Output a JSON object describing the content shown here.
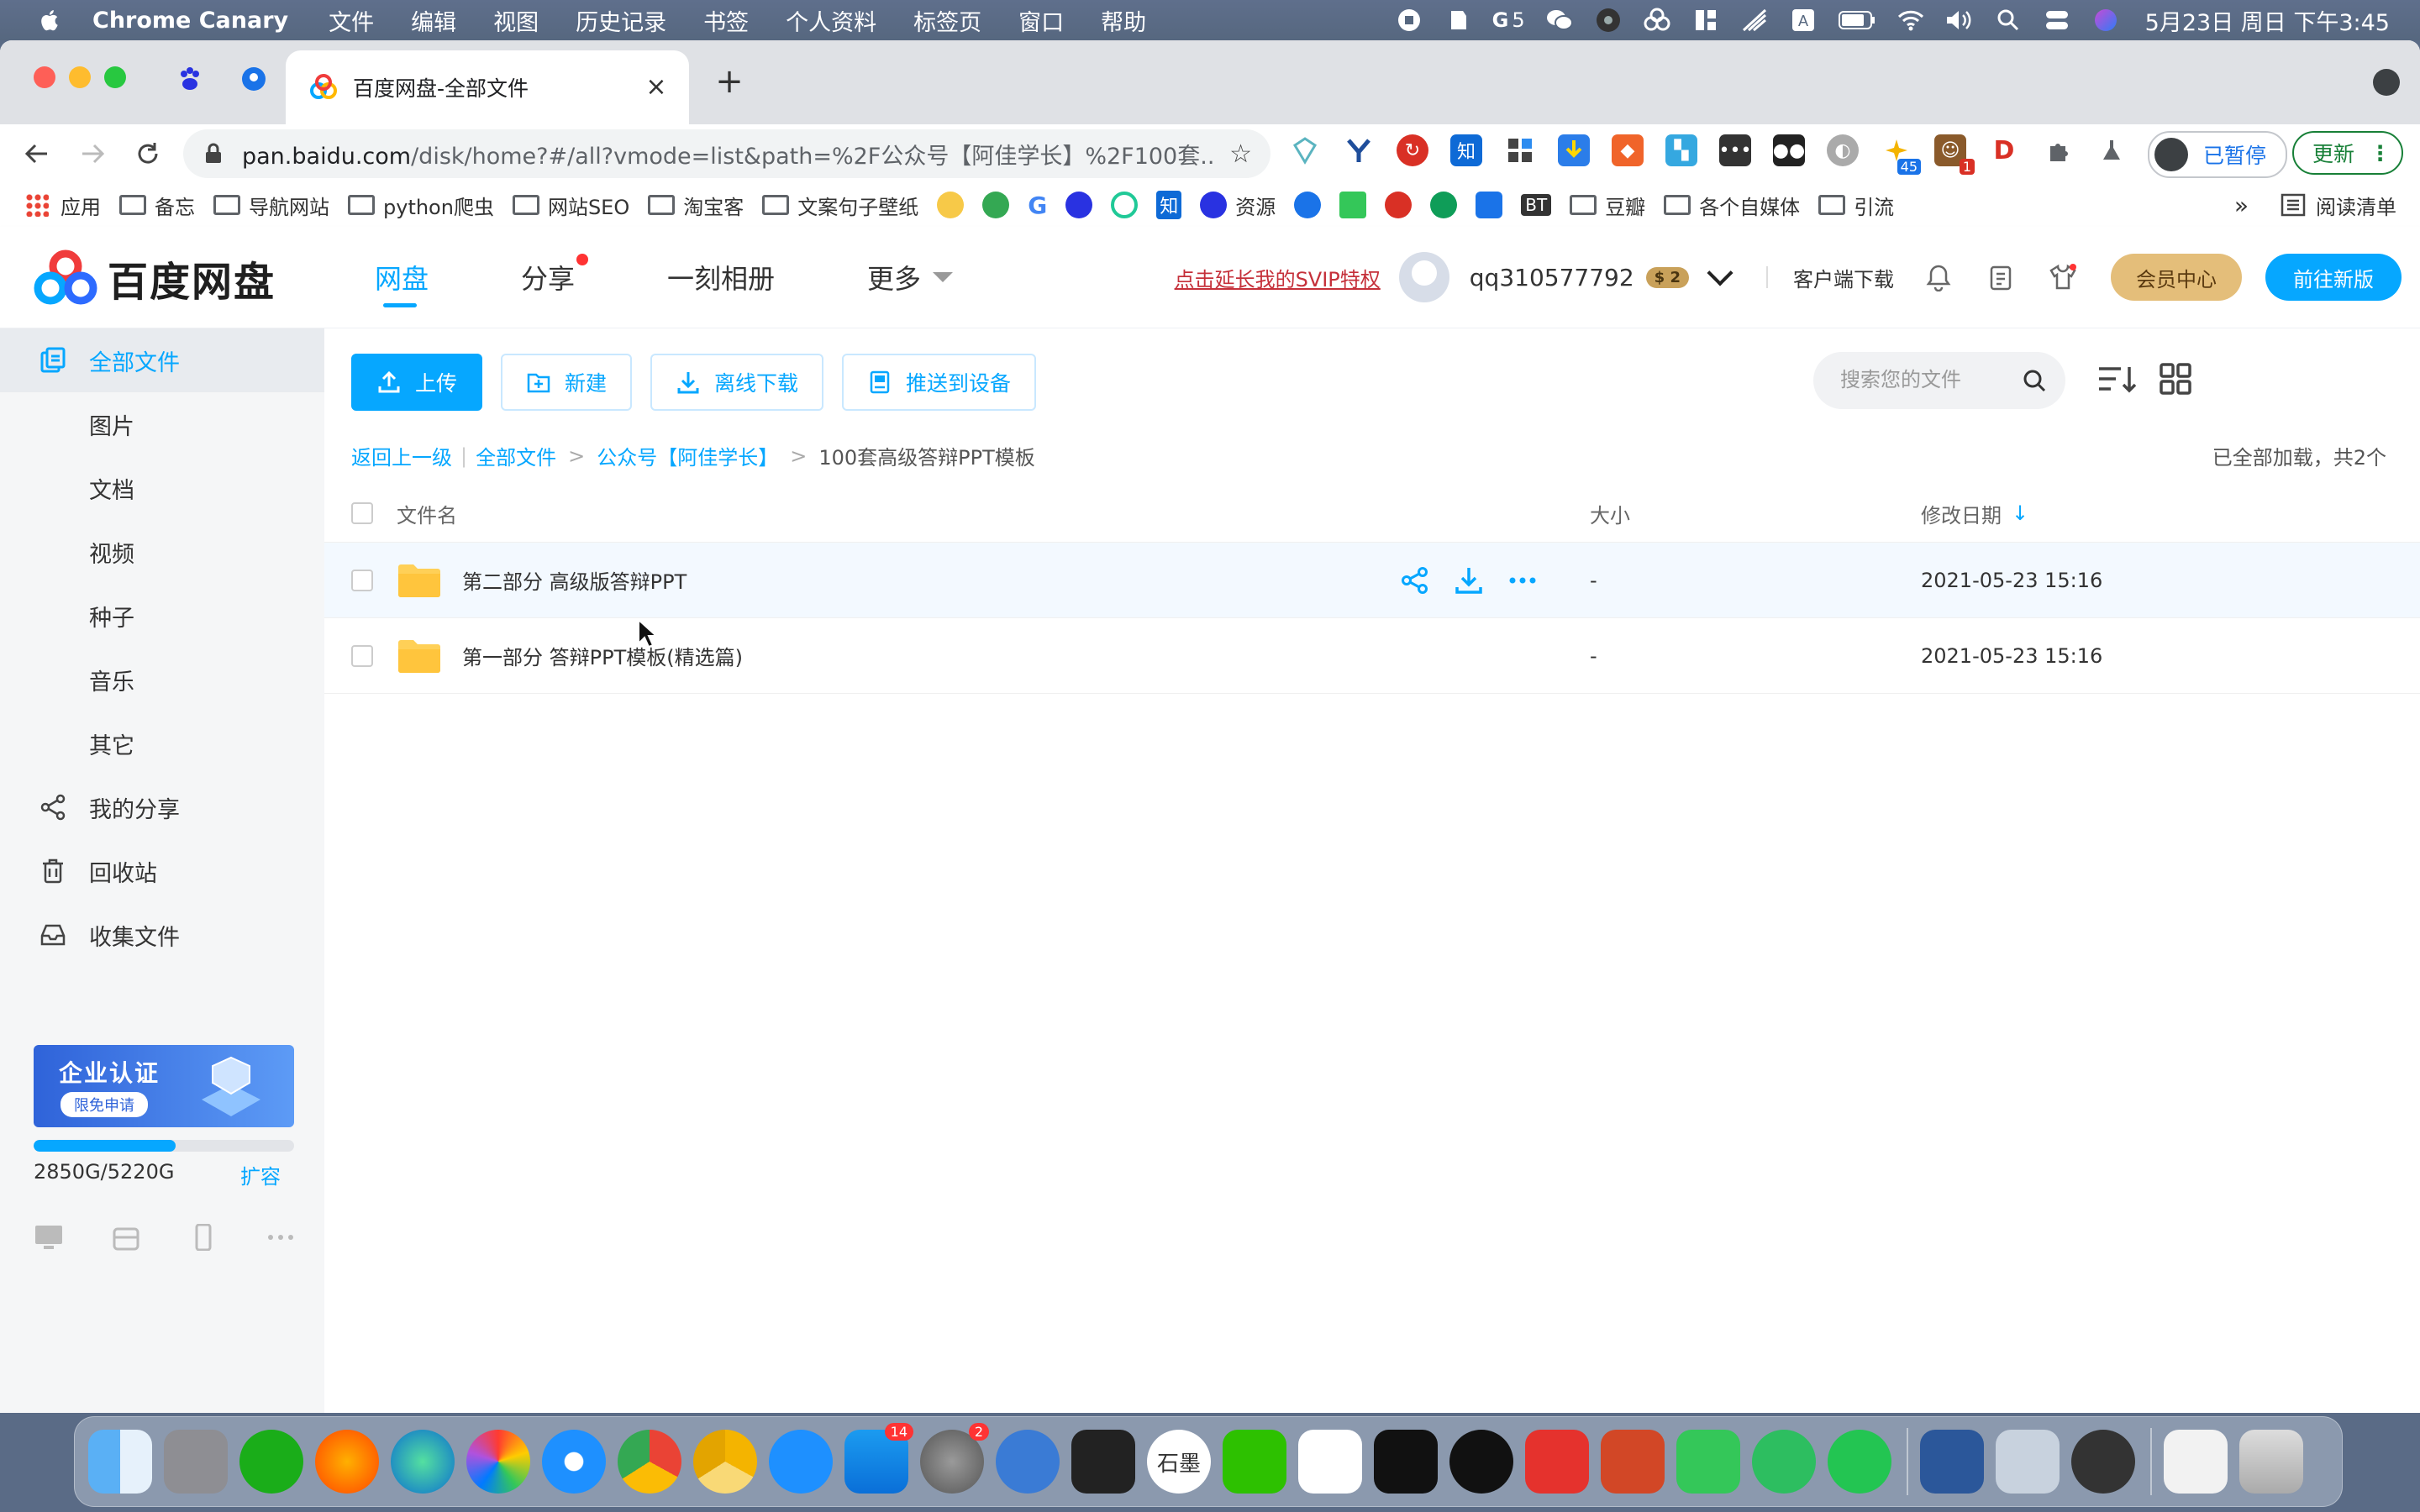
{
  "menubar": {
    "app": "Chrome Canary",
    "items": [
      "文件",
      "编辑",
      "视图",
      "历史记录",
      "书签",
      "个人资料",
      "标签页",
      "窗口",
      "帮助"
    ],
    "tray_badge": "5",
    "clock": "5月23日 周日 下午3:45"
  },
  "browser": {
    "tab_title": "百度网盘-全部文件",
    "url_domain": "pan.baidu.com",
    "url_rest": "/disk/home?#/all?vmode=list&path=%2F公众号【阿佳学长】%2F100套...",
    "ext_badge_1": "45",
    "ext_badge_2": "1",
    "paused_label": "已暂停",
    "update_label": "更新",
    "bookmarks": [
      "应用",
      "备忘",
      "导航网站",
      "python爬虫",
      "网站SEO",
      "淘宝客",
      "文案句子壁纸",
      "资源",
      "豆瓣",
      "各个自媒体",
      "引流"
    ],
    "bookmark_bt": "BT",
    "more": "»",
    "reading_list": "阅读清单"
  },
  "header": {
    "logo": "百度网盘",
    "nav": [
      "网盘",
      "分享",
      "一刻相册",
      "更多"
    ],
    "svip_link": "点击延长我的SVIP特权",
    "username": "qq310577792",
    "level_badge": "2",
    "client_download": "客户端下载",
    "vip_center": "会员中心",
    "new_version": "前往新版"
  },
  "sidebar": {
    "items": [
      "全部文件",
      "图片",
      "文档",
      "视频",
      "种子",
      "音乐",
      "其它",
      "我的分享",
      "回收站",
      "收集文件"
    ],
    "promo_title": "企业认证",
    "promo_sub": "限免申请",
    "quota_text": "2850G/5220G",
    "quota_fraction": 0.546,
    "expand": "扩容"
  },
  "toolbar": {
    "upload": "上传",
    "new": "新建",
    "offline": "离线下载",
    "push": "推送到设备",
    "search_placeholder": "搜索您的文件"
  },
  "breadcrumb": {
    "back": "返回上一级",
    "all": "全部文件",
    "parent": "公众号【阿佳学长】",
    "current": "100套高级答辩PPT模板",
    "loaded": "已全部加载，共2个"
  },
  "table": {
    "headers": {
      "name": "文件名",
      "size": "大小",
      "date": "修改日期"
    },
    "rows": [
      {
        "name": "第二部分 高级版答辩PPT",
        "size": "-",
        "date": "2021-05-23 15:16"
      },
      {
        "name": "第一部分 答辩PPT模板(精选篇)",
        "size": "-",
        "date": "2021-05-23 15:16"
      }
    ]
  },
  "dock": {
    "appstore_badge": "14",
    "settings_badge": "2",
    "shimo_label": "石墨"
  }
}
